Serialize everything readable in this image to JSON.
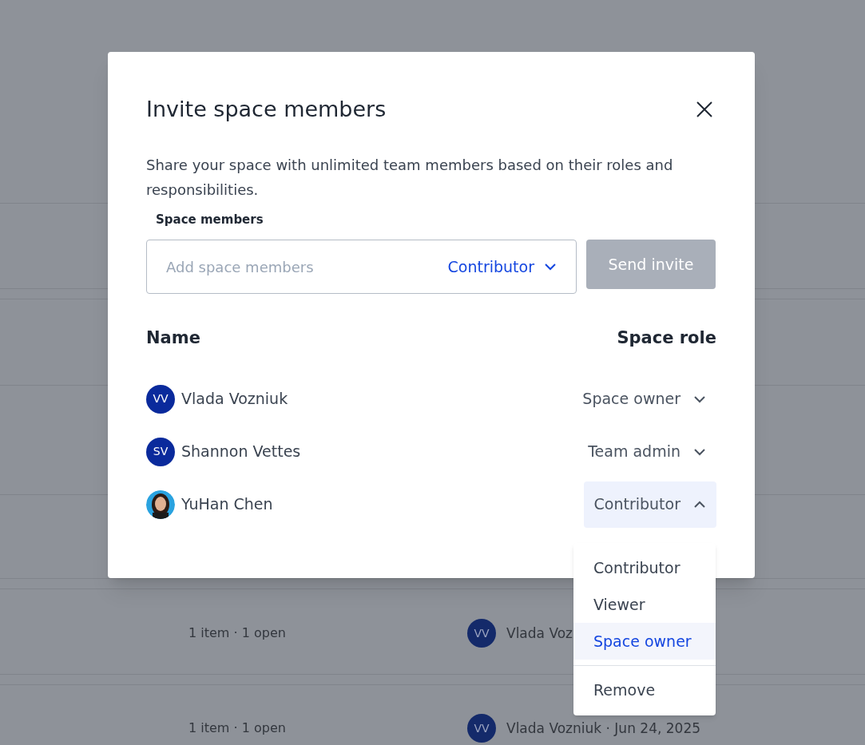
{
  "background_rows": [
    {
      "summary": "1 item · 1 open",
      "owner_initials": "VV",
      "owner": "Vlada Voz"
    },
    {
      "summary": "1 item · 1 open",
      "owner_initials": "VV",
      "owner": "Vlada Vozniuk · Jun 24, 2025"
    }
  ],
  "dialog": {
    "title": "Invite space members",
    "description": "Share your space with unlimited team members based on their roles and responsibilities.",
    "field_label": "Space members",
    "input": {
      "placeholder": "Add space members"
    },
    "role_select": "Contributor",
    "send_button": {
      "label": "Send invite",
      "disabled": true
    },
    "columns": [
      "Name",
      "Space role"
    ],
    "members": [
      {
        "avatar": {
          "kind": "initials",
          "text": "VV"
        },
        "name": "Vlada Vozniuk",
        "role": "Space owner",
        "expanded": false
      },
      {
        "avatar": {
          "kind": "initials",
          "text": "SV"
        },
        "name": "Shannon Vettes",
        "role": "Team admin",
        "expanded": false
      },
      {
        "name": "YuHan Chen",
        "role": "Contributor",
        "expanded": true
      }
    ]
  },
  "role_menu": [
    {
      "label": "Contributor",
      "kind": "option",
      "selected": false
    },
    {
      "label": "Viewer",
      "kind": "option",
      "selected": false
    },
    {
      "label": "Space owner",
      "kind": "option",
      "selected": true
    },
    {
      "label": "Remove",
      "kind": "action",
      "selected": false
    }
  ]
}
